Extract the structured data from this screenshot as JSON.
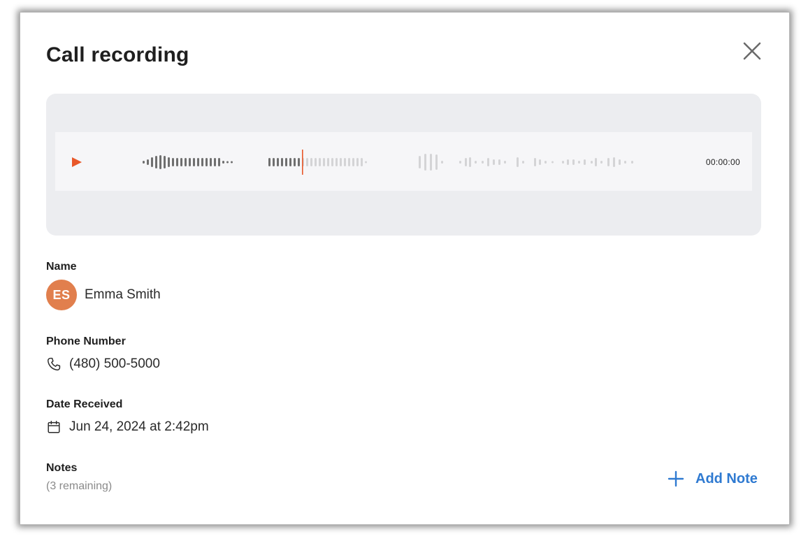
{
  "modal": {
    "title": "Call recording",
    "close_label": "close-icon"
  },
  "player": {
    "time": "00:00:00",
    "accent_color": "#e8582a"
  },
  "fields": {
    "name_label": "Name",
    "name_initials": "ES",
    "name_value": "Emma Smith",
    "avatar_color": "#e17f4d",
    "phone_label": "Phone Number",
    "phone_value": "(480) 500-5000",
    "date_label": "Date Received",
    "date_value": "Jun 24, 2024 at 2:42pm",
    "notes_label": "Notes",
    "notes_remaining": "(3 remaining)"
  },
  "actions": {
    "add_note_label": "Add Note",
    "add_note_color": "#2f7ad1"
  }
}
